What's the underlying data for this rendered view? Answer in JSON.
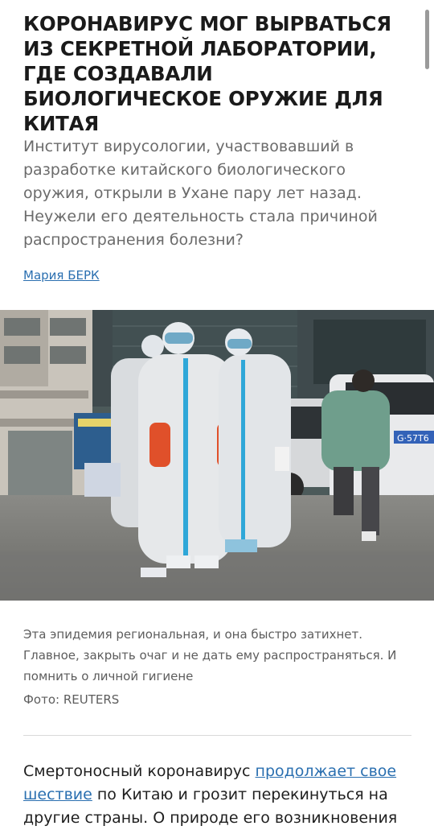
{
  "article": {
    "headline": "КОРОНАВИРУС МОГ ВЫРВАТЬСЯ ИЗ СЕКРЕТНОЙ ЛАБОРАТОРИИ, ГДЕ СОЗДАВАЛИ БИОЛОГИЧЕСКОЕ ОРУЖИЕ ДЛЯ КИТАЯ",
    "lead": "Институт вирусологии, участвовавший в разработке китайского биологического оружия, открыли в Ухане пару лет назад. Неужели его деятельность стала причиной распространения болезни?",
    "author": "Мария БЕРК",
    "photo": {
      "plate_text": "G·57T6",
      "caption": "Эта эпидемия региональная, и она быстро затихнет. Главное, закрыть очаг и не дать ему распространяться. И помнить о личной гигиене",
      "credit": "Фото: REUTERS"
    },
    "body": {
      "text_before_link": "Смертоносный коронавирус ",
      "link_text": "продолжает свое шествие",
      "text_after_link": " по Китаю и грозит перекинуться на другие страны. О природе его возникновения"
    }
  },
  "colors": {
    "link": "#2a6fb0",
    "lead_text": "#6b6b6b",
    "caption_text": "#5d5d5d",
    "suit": "#e6e8ea",
    "suit_tape": "#2fa7d8",
    "gloves": "#e0502a"
  }
}
